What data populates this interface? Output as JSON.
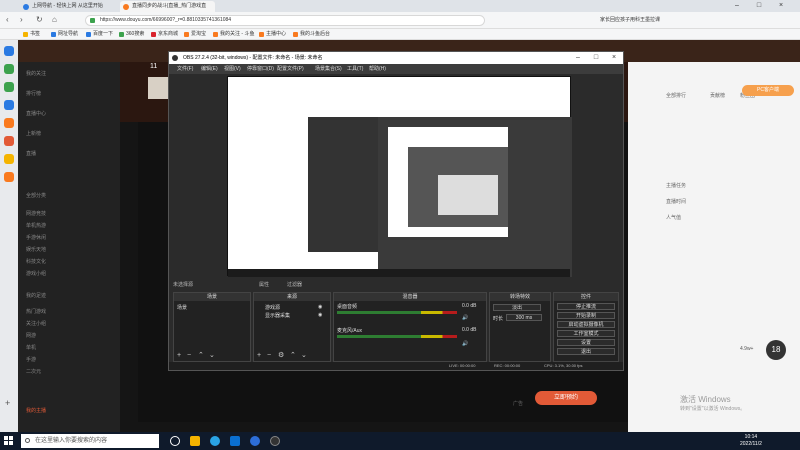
{
  "browser": {
    "tabs": [
      {
        "label": "上网导航 - 轻快上网 从这里开始"
      },
      {
        "label": "直播同步的战斗|直播_热门游戏直"
      }
    ],
    "address": "https://www.douyu.com/6699600?_r=0.8810335741361084",
    "bookmarks": [
      "书签",
      "网址导航",
      "百度一下",
      "360搜索",
      "京东商城",
      "爱淘宝",
      "我的关注 - 斗鱼",
      "主播中心",
      "我的斗鱼后台"
    ],
    "search_hint": "家长回应孩子用科王墨拉课"
  },
  "site": {
    "left_nav": [
      "我的关注",
      "排行榜",
      "直播中心",
      "上新榜",
      "直播",
      "全部分类",
      "网游竞技",
      "单机热游",
      "手游休闲",
      "娱乐天地",
      "科技文化",
      "游戏小组",
      "我的足迹",
      "热门游戏",
      "关注小组",
      "网游",
      "单机",
      "手游",
      "二次元",
      "我的主播"
    ],
    "room_number": "11",
    "pc_button": "PC客户端",
    "sign_button": "立即预约",
    "ad_label": "广告",
    "activation_title": "激活 Windows",
    "activation_sub": "转到\"设置\"以激活 Windows。",
    "right_items": [
      "全部排行",
      "贡献榜",
      "粉丝团",
      "主播任务",
      "直播时间",
      "人气值"
    ],
    "danmu_count": "18",
    "danmu_badge": "4.9w+"
  },
  "obs": {
    "title": "OBS 27.2.4 (32-bit, windows) - 配置文件: 未命名 - 场景: 未命名",
    "menu": [
      "文件(F)",
      "编辑(E)",
      "视图(V)",
      "停靠窗口(D)",
      "配置文件(P)",
      "场景集合(S)",
      "工具(T)",
      "帮助(H)"
    ],
    "scene_label": "未选择源",
    "scene_buttons": [
      "属性",
      "过滤器"
    ],
    "panels": {
      "scenes": {
        "title": "场景",
        "items": [
          "场景"
        ]
      },
      "sources": {
        "title": "来源",
        "items": [
          "游戏源",
          "显示器采集"
        ]
      },
      "mixer": {
        "title": "混音器",
        "channels": [
          {
            "name": "桌面音频",
            "db": "0.0 dB"
          },
          {
            "name": "麦克风/Aux",
            "db": "0.0 dB"
          }
        ]
      },
      "transitions": {
        "title": "转场特效",
        "type": "淡出",
        "duration_label": "时长",
        "duration": "300 ms"
      },
      "controls": {
        "title": "控件",
        "buttons": [
          "停止推流",
          "开始录制",
          "启动虚拟摄像机",
          "工作室模式",
          "设置",
          "退出"
        ]
      }
    },
    "status": {
      "live": "LIVE: 00:00:00",
      "rec": "REC: 00:00:00",
      "cpu": "CPU: 3.1%, 30.00 fps"
    }
  },
  "taskbar": {
    "search_placeholder": "在这里输入你要搜索的内容",
    "time": "10:14",
    "date": "2022/11/2"
  }
}
